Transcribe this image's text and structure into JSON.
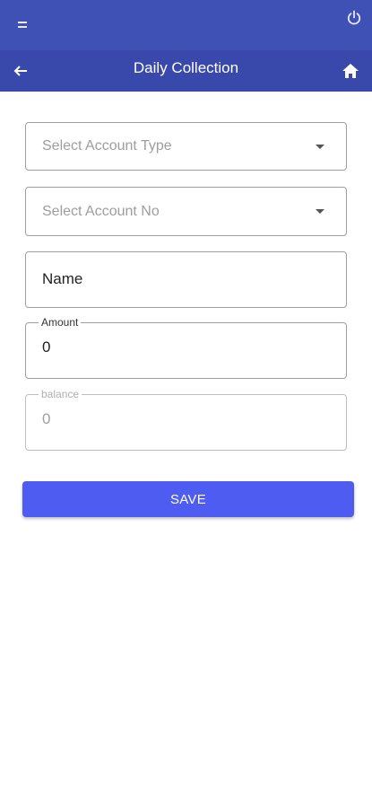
{
  "header": {
    "title": "Daily Collection",
    "icons": {
      "menu": "menu-icon",
      "power": "power-icon",
      "back": "back-arrow-icon",
      "home": "home-icon"
    },
    "colors": {
      "status_bar": "#3f51b5",
      "app_bar": "#3949ab"
    }
  },
  "form": {
    "account_type": {
      "placeholder": "Select Account Type"
    },
    "account_no": {
      "placeholder": "Select Account No"
    },
    "name": {
      "placeholder": "Name"
    },
    "amount": {
      "label": "Amount",
      "value": "0"
    },
    "balance": {
      "label": "balance",
      "value": "0"
    },
    "save_label": "SAVE",
    "save_color": "#4f5cf2"
  }
}
